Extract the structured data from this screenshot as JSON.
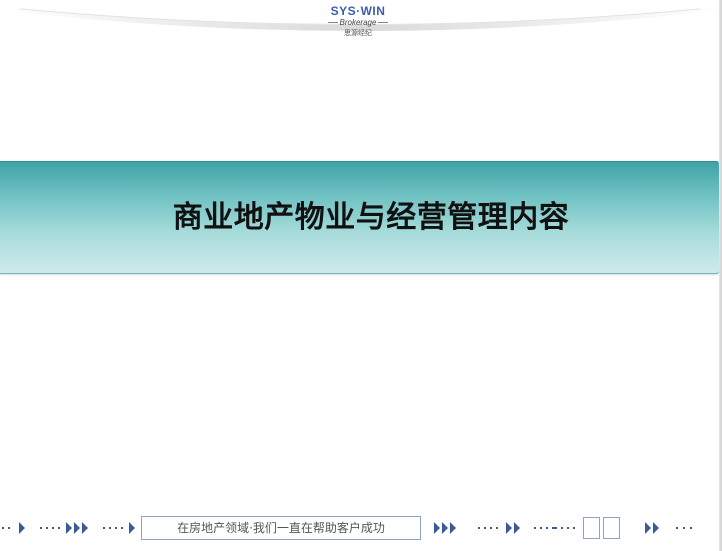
{
  "logo": {
    "brand": "SYS·WIN",
    "sub": "Brokerage",
    "cn": "思源经纪"
  },
  "slide": {
    "title": "商业地产物业与经营管理内容"
  },
  "footer": {
    "slogan": "在房地产领域·我们一直在帮助客户成功"
  },
  "colors": {
    "band_top": "#3fa3a6",
    "band_bottom": "#cfeaea",
    "arrow_blue": "#3b5a9a",
    "logo_blue": "#3a5fa8"
  }
}
